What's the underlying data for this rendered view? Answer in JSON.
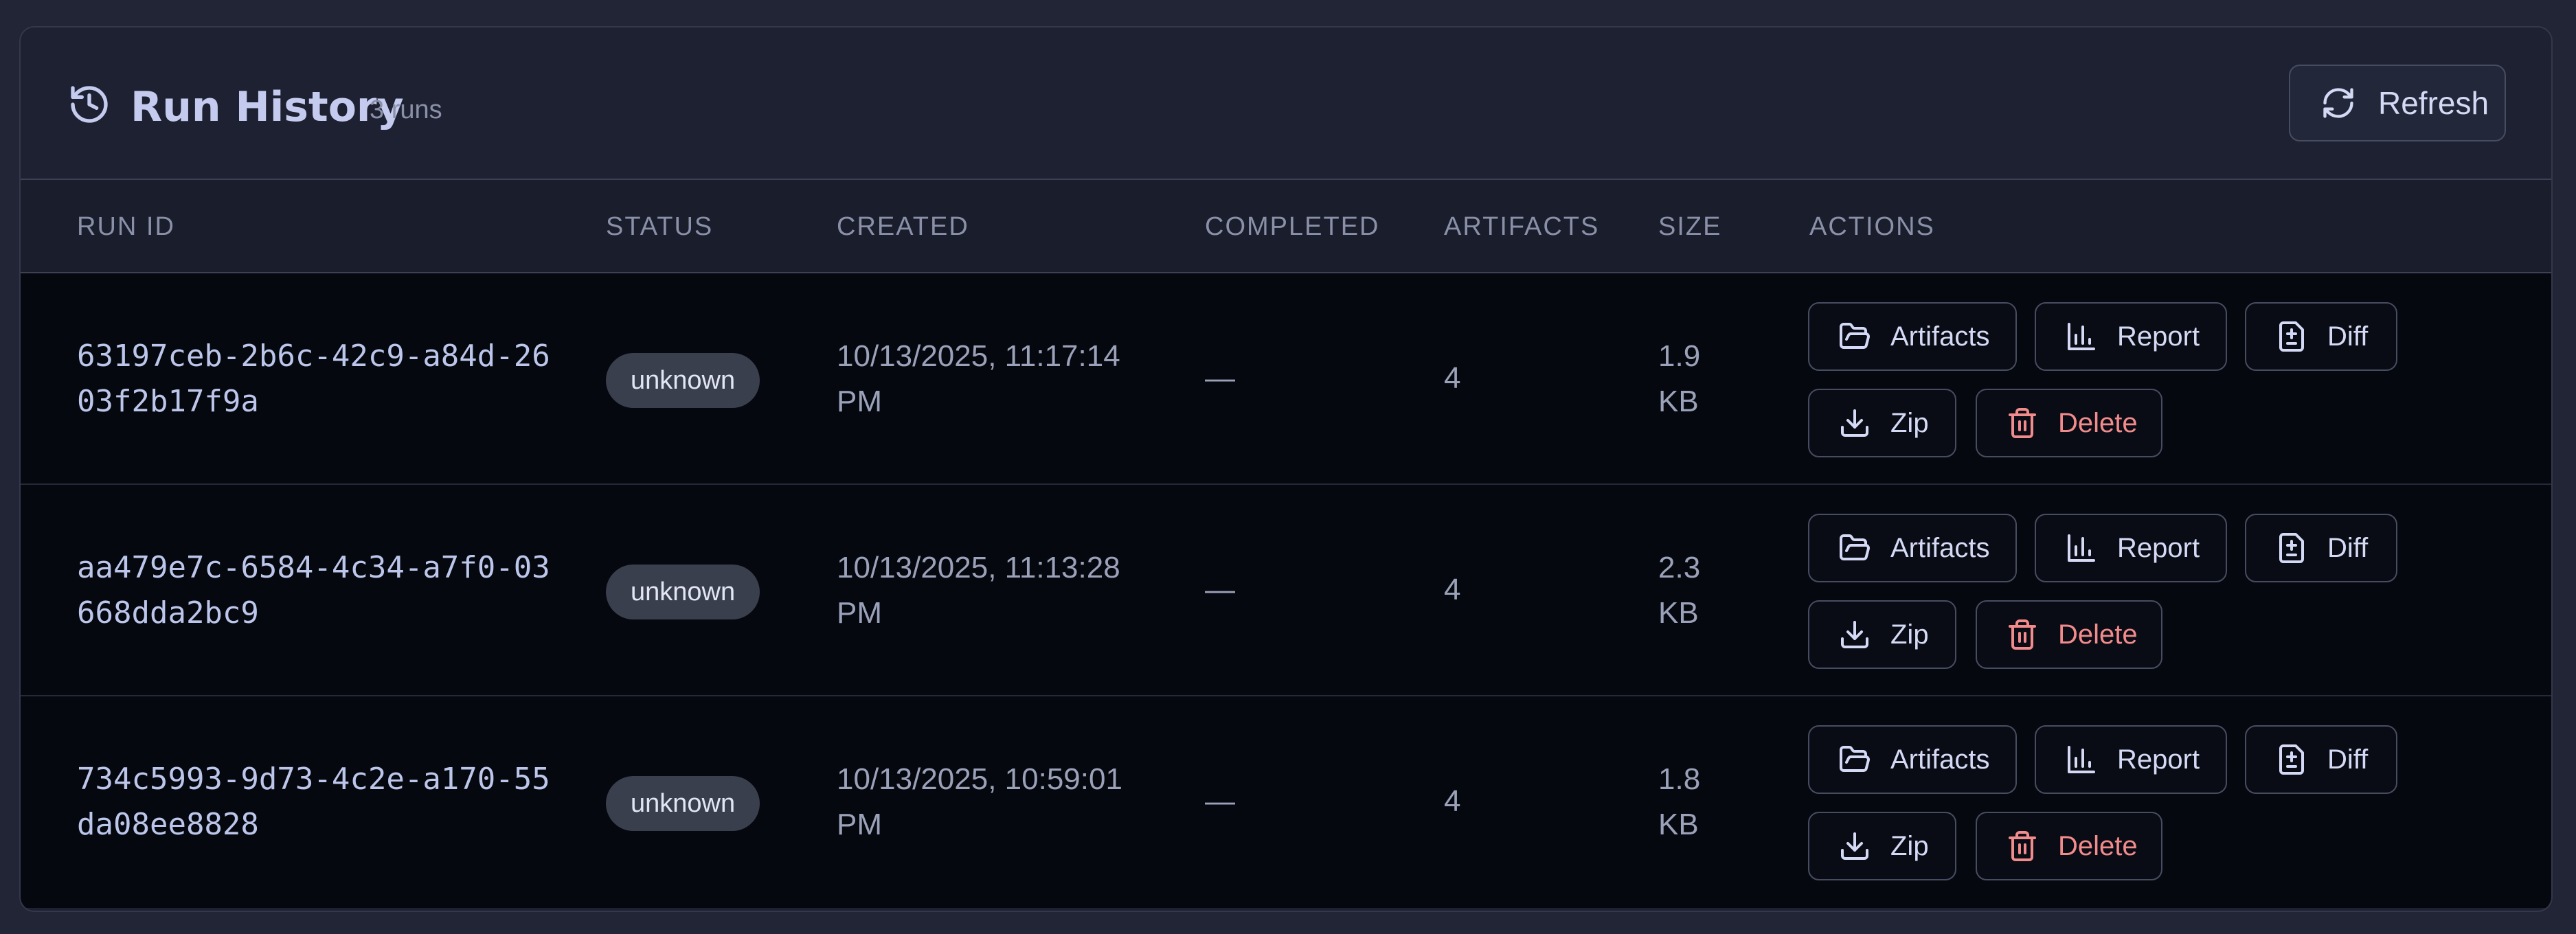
{
  "header": {
    "title": "Run History",
    "count": "3 runs",
    "refresh_label": "Refresh"
  },
  "table": {
    "columns": [
      "RUN ID",
      "STATUS",
      "CREATED",
      "COMPLETED",
      "ARTIFACTS",
      "SIZE",
      "ACTIONS"
    ],
    "rows": [
      {
        "run_id": "63197ceb-2b6c-42c9-a84d-2603f2b17f9a",
        "status": "unknown",
        "created": "10/13/2025, 11:17:14 PM",
        "completed": "—",
        "artifacts": "4",
        "size": "1.9 KB"
      },
      {
        "run_id": "aa479e7c-6584-4c34-a7f0-03668dda2bc9",
        "status": "unknown",
        "created": "10/13/2025, 11:13:28 PM",
        "completed": "—",
        "artifacts": "4",
        "size": "2.3 KB"
      },
      {
        "run_id": "734c5993-9d73-4c2e-a170-55da08ee8828",
        "status": "unknown",
        "created": "10/13/2025, 10:59:01 PM",
        "completed": "—",
        "artifacts": "4",
        "size": "1.8 KB"
      }
    ],
    "actions": {
      "artifacts": "Artifacts",
      "report": "Report",
      "diff": "Diff",
      "zip": "Zip",
      "delete": "Delete"
    }
  },
  "icons": {
    "title": "history-icon",
    "refresh": "refresh-icon",
    "artifacts": "folder-open-icon",
    "report": "bar-chart-icon",
    "diff": "file-diff-icon",
    "zip": "download-icon",
    "delete": "trash-icon"
  },
  "colors": {
    "background": "#222536",
    "panel": "#1e2131",
    "row": "#06080f",
    "accent_text": "#c4cbef",
    "danger": "#f28b8b",
    "badge": "#3a3f4e"
  }
}
